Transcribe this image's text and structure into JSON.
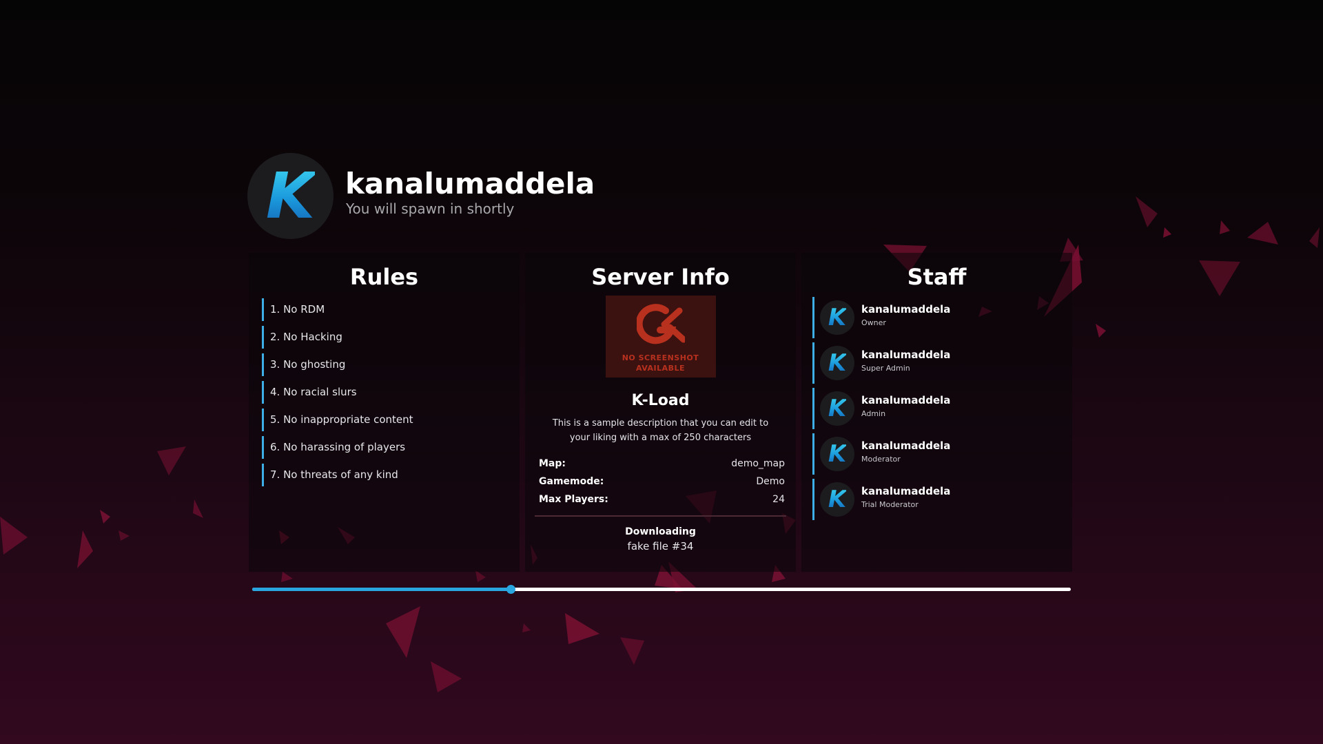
{
  "header": {
    "logo_letter": "K",
    "server_name": "kanalumaddela",
    "tagline": "You will spawn in shortly"
  },
  "rules": {
    "title": "Rules",
    "items": [
      "1. No RDM",
      "2. No Hacking",
      "3. No ghosting",
      "4. No racial slurs",
      "5. No inappropriate content",
      "6. No harassing of players",
      "7. No threats of any kind"
    ]
  },
  "server_info": {
    "title": "Server Info",
    "screenshot_line1": "NO SCREENSHOT",
    "screenshot_line2": "AVAILABLE",
    "gamemode_name": "K-Load",
    "description": "This is a sample description that you can edit to your liking with a max of 250 characters",
    "rows": [
      {
        "key": "Map:",
        "value": "demo_map"
      },
      {
        "key": "Gamemode:",
        "value": "Demo"
      },
      {
        "key": "Max Players:",
        "value": "24"
      }
    ],
    "download_status": "Downloading",
    "download_file": "fake file #34"
  },
  "staff": {
    "title": "Staff",
    "members": [
      {
        "name": "kanalumaddela",
        "role": "Owner"
      },
      {
        "name": "kanalumaddela",
        "role": "Super Admin"
      },
      {
        "name": "kanalumaddela",
        "role": "Admin"
      },
      {
        "name": "kanalumaddela",
        "role": "Moderator"
      },
      {
        "name": "kanalumaddela",
        "role": "Trial Moderator"
      }
    ]
  },
  "progress": {
    "fraction": 0.316
  },
  "colors": {
    "accent": "#29a5e0",
    "logo_gradient_top": "#3ad0ee",
    "logo_gradient_bottom": "#1564b4",
    "shard": "#7a1032",
    "no_screenshot": "#b8301e"
  },
  "icons": {
    "logo": "k-logo-icon",
    "map_placeholder": "gmod-logo-icon"
  }
}
